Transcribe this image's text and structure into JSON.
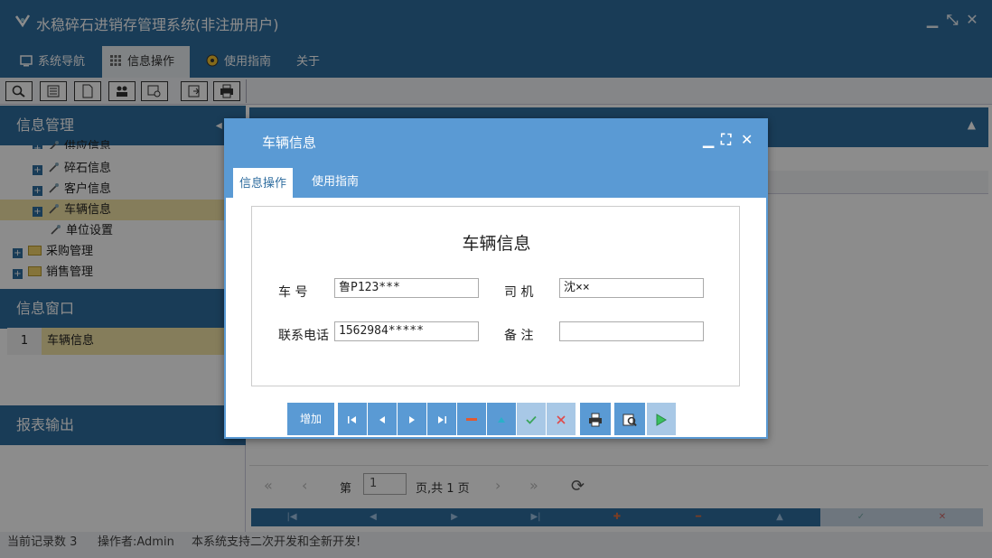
{
  "app": {
    "title": "水稳碎石进销存管理系统(非注册用户)",
    "window_controls": {
      "minimize": "▁",
      "restore": "⤡",
      "close": "✕"
    }
  },
  "menu": {
    "tabs": [
      {
        "label": "系统导航",
        "icon": "monitor-icon",
        "active": false
      },
      {
        "label": "信息操作",
        "icon": "grid-icon",
        "active": true
      },
      {
        "label": "使用指南",
        "icon": "help-circle-icon",
        "active": false
      },
      {
        "label": "关于",
        "icon": "",
        "active": false
      }
    ]
  },
  "toolbar": {
    "buttons": [
      "search-icon",
      "list-icon",
      "document-icon",
      "users-icon",
      "window-search-icon",
      "export-icon",
      "print-icon"
    ]
  },
  "left_panel": {
    "info_mgmt": {
      "title": "信息管理",
      "controls": "◂ ✚",
      "items": [
        {
          "label": "供应信息",
          "type": "leaf-expand"
        },
        {
          "label": "碎石信息",
          "type": "leaf-expand"
        },
        {
          "label": "客户信息",
          "type": "leaf-expand"
        },
        {
          "label": "车辆信息",
          "type": "leaf-expand",
          "selected": true
        },
        {
          "label": "单位设置",
          "type": "leaf"
        },
        {
          "label": "采购管理",
          "type": "folder"
        },
        {
          "label": "销售管理",
          "type": "folder"
        }
      ]
    },
    "info_window": {
      "title": "信息窗口",
      "rows": [
        {
          "index": "1",
          "name": "车辆信息"
        }
      ]
    },
    "report": {
      "title": "报表输出"
    }
  },
  "pager": {
    "page_label": "第",
    "page_value": "1",
    "total_label": "页,共 1 页"
  },
  "status": {
    "record_count": "当前记录数 3",
    "operator": "操作者:Admin",
    "message": "本系统支持二次开发和全新开发!"
  },
  "dialog": {
    "title": "车辆信息",
    "tabs": [
      {
        "label": "信息操作",
        "active": true
      },
      {
        "label": "使用指南",
        "active": false
      }
    ],
    "form_title": "车辆信息",
    "fields": {
      "plate_label": "车 号",
      "plate_value": "鲁P123***",
      "driver_label": "司 机",
      "driver_value": "沈××",
      "phone_label": "联系电话",
      "phone_value": "1562984*****",
      "remark_label": "备 注",
      "remark_value": ""
    },
    "buttons": {
      "add_label": "增加"
    }
  },
  "colors": {
    "primary": "#2f6d9f",
    "dialog_primary": "#5a9ad4",
    "selected_row": "#f3e3a6"
  }
}
